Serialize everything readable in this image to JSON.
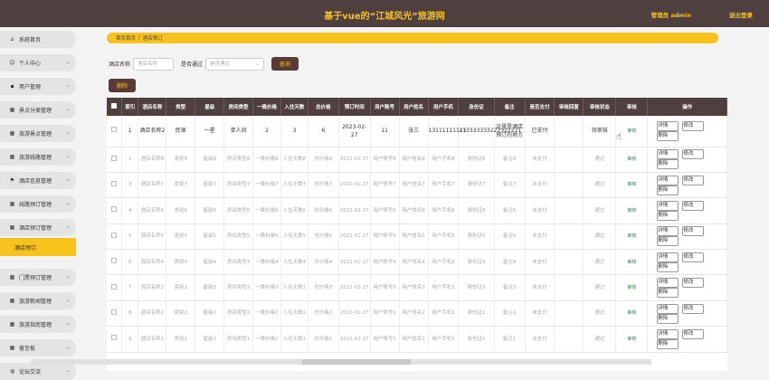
{
  "header": {
    "title": "基于vue的“江城风光”旅游网",
    "user": "管理员 admin",
    "logout": "退出登录"
  },
  "sidebar": {
    "items": [
      {
        "label": "系统首页",
        "icon": "home-icon"
      },
      {
        "label": "个人中心",
        "icon": "person-icon"
      },
      {
        "label": "用户管理",
        "icon": "user-icon"
      },
      {
        "label": "景点分类管理",
        "icon": "grid-icon"
      },
      {
        "label": "旅游景点管理",
        "icon": "grid-icon"
      },
      {
        "label": "旅游线路管理",
        "icon": "grid-icon"
      },
      {
        "label": "酒店信息管理",
        "icon": "flag-icon"
      },
      {
        "label": "线路预订管理",
        "icon": "grid-icon"
      },
      {
        "label": "酒店预订管理",
        "icon": "grid-icon"
      },
      {
        "label": "门票预订管理",
        "icon": "grid-icon"
      },
      {
        "label": "旅游新闻管理",
        "icon": "grid-icon"
      },
      {
        "label": "旅游指南管理",
        "icon": "grid-icon"
      },
      {
        "label": "留言板",
        "icon": "grid-icon"
      },
      {
        "label": "论坛交流",
        "icon": "globe-icon"
      }
    ],
    "active_sub": "酒店预订"
  },
  "breadcrumb": {
    "home": "首页首页",
    "sep": "/",
    "current": "酒店预订"
  },
  "search": {
    "hotel_label": "酒店名称",
    "hotel_placeholder": "酒店名称",
    "pass_label": "是否通过",
    "pass_placeholder": "是否通过",
    "search_button": "查询"
  },
  "delete_button": "删除",
  "table": {
    "headers": [
      "索引",
      "酒店名称",
      "类型",
      "星级",
      "房间类型",
      "一晚价格",
      "入住天数",
      "总价格",
      "预订时间",
      "用户账号",
      "用户姓名",
      "用户手机",
      "身份证",
      "备注",
      "是否支付",
      "审核回复",
      "审核状态",
      "审核",
      "操作"
    ],
    "rows": [
      [
        "1",
        "酒店名称2",
        "民宿",
        "一星",
        "单人间",
        "2",
        "3",
        "6",
        "2023-02-27",
        "11",
        "张三",
        "13111111111",
        "233333333222322221",
        "这里是酒店预订的地方",
        "已支付",
        "",
        "待审核",
        "审核"
      ],
      [
        "2",
        "酒店名称8",
        "类别8",
        "星级8",
        "房间类型8",
        "一晚价格8",
        "入住天数8",
        "总价格8",
        "2021-02-27",
        "用户账号8",
        "用户姓名8",
        "用户手机8",
        "身份证8",
        "备注8",
        "未支付",
        "",
        "通过",
        "审核"
      ],
      [
        "3",
        "酒店名称7",
        "类别7",
        "星级7",
        "房间类型7",
        "一晚价格7",
        "入住天数7",
        "总价格7",
        "2021-02-27",
        "用户账号7",
        "用户姓名7",
        "用户手机7",
        "身份证7",
        "备注7",
        "未支付",
        "",
        "通过",
        "审核"
      ],
      [
        "4",
        "酒店名称6",
        "类别6",
        "星级6",
        "房间类型6",
        "一晚价格6",
        "入住天数6",
        "总价格6",
        "2021-02-27",
        "用户账号6",
        "用户姓名6",
        "用户手机6",
        "身份证6",
        "备注6",
        "未支付",
        "",
        "通过",
        "审核"
      ],
      [
        "5",
        "酒店名称5",
        "类别5",
        "星级5",
        "房间类型5",
        "一晚价格5",
        "入住天数5",
        "总价格5",
        "2021-02-27",
        "用户账号5",
        "用户姓名5",
        "用户手机5",
        "身份证5",
        "备注5",
        "未支付",
        "",
        "通过",
        "审核"
      ],
      [
        "6",
        "酒店名称4",
        "类别4",
        "星级4",
        "房间类型4",
        "一晚价格4",
        "入住天数4",
        "总价格4",
        "2021-02-27",
        "用户账号4",
        "用户姓名4",
        "用户手机4",
        "身份证4",
        "备注4",
        "未支付",
        "",
        "通过",
        "审核"
      ],
      [
        "7",
        "酒店名称3",
        "类别3",
        "星级3",
        "房间类型3",
        "一晚价格3",
        "入住天数3",
        "总价格3",
        "2021-02-27",
        "用户账号3",
        "用户姓名3",
        "用户手机3",
        "身份证3",
        "备注3",
        "未支付",
        "",
        "通过",
        "审核"
      ],
      [
        "8",
        "酒店名称2",
        "类别2",
        "星级2",
        "房间类型2",
        "一晚价格2",
        "入住天数2",
        "总价格2",
        "2021-02-27",
        "用户账号2",
        "用户姓名2",
        "用户手机2",
        "身份证2",
        "备注2",
        "未支付",
        "",
        "通过",
        "审核"
      ],
      [
        "9",
        "酒店名称1",
        "类别1",
        "星级1",
        "房间类型1",
        "一晚价格1",
        "入住天数1",
        "总价格1",
        "2021-02-27",
        "用户账号1",
        "用户姓名1",
        "用户手机1",
        "身份证1",
        "备注1",
        "未支付",
        "",
        "通过",
        "审核"
      ]
    ],
    "actions": [
      "详情",
      "修改",
      "删除"
    ]
  },
  "colors": {
    "accent": "#f7c21c",
    "header_bg": "#4f3f3f",
    "button_bg": "#5a3a37"
  }
}
